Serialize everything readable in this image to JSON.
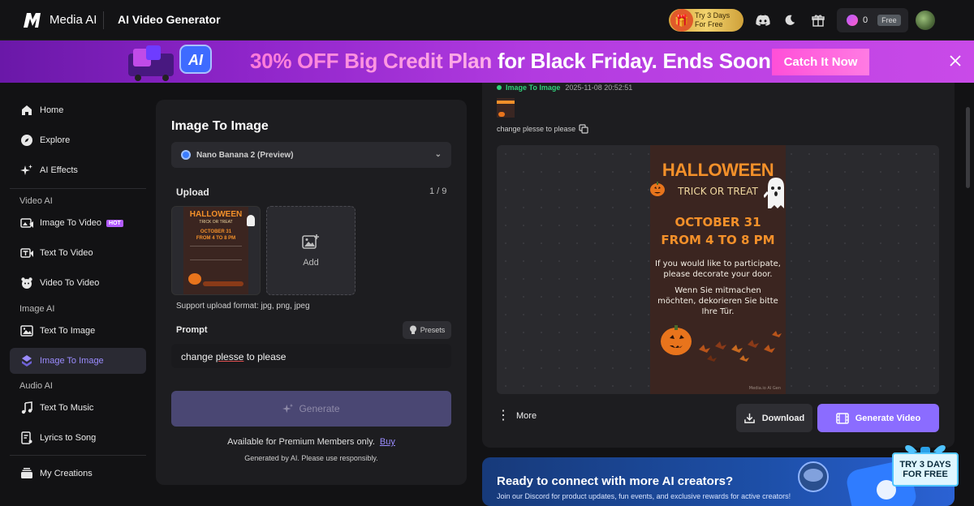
{
  "app": {
    "brand": "Media AI",
    "tool_title": "AI Video Generator"
  },
  "topbar": {
    "trial_line1": "Try 3 Days",
    "trial_line2": "For Free",
    "credits": "0",
    "plan_badge": "Free"
  },
  "banner": {
    "highlight": "30% OFF Big Credit Plan",
    "rest": " for Black Friday. Ends Soon.",
    "cta": "Catch It Now",
    "ai_badge": "AI"
  },
  "sidebar": {
    "home": "Home",
    "explore": "Explore",
    "ai_effects": "AI Effects",
    "section_video": "Video AI",
    "image_to_video": "Image To Video",
    "hot": "HOT",
    "text_to_video": "Text To Video",
    "video_to_video": "Video To Video",
    "section_image": "Image AI",
    "text_to_image": "Text To Image",
    "image_to_image": "Image To Image",
    "section_audio": "Audio AI",
    "text_to_music": "Text To Music",
    "lyrics_to_song": "Lyrics to Song",
    "my_creations": "My Creations"
  },
  "panel": {
    "title": "Image To Image",
    "model": "Nano Banana 2 (Preview)",
    "upload_label": "Upload",
    "upload_count": "1 / 9",
    "add_label": "Add",
    "support": "Support upload format: jpg, png, jpeg",
    "prompt_label": "Prompt",
    "presets": "Presets",
    "prompt_before": "change ",
    "prompt_misspelled": "plesse",
    "prompt_after": " to please",
    "generate": "Generate",
    "available": "Available for Premium Members only.",
    "buy": "Buy",
    "disclaimer": "Generated by AI. Please use responsibly."
  },
  "result": {
    "tag": "Image To Image",
    "time": "2025-11-08 20:52:51",
    "prompt": "change plesse to please",
    "more": "More",
    "download": "Download",
    "generate_video": "Generate Video"
  },
  "poster": {
    "title": "HALLOWEEN",
    "subtitle": "TRICK OR TREAT",
    "date1": "OCTOBER 31",
    "date2": "FROM 4 TO 8 PM",
    "english": "If you would like to participate, please decorate your door.",
    "german": "Wenn Sie mitmachen möchten, dekorieren Sie bitte Ihre Tür.",
    "watermark": "Media.io AI Gen"
  },
  "thumb_poster": {
    "title": "HALLOWEEN",
    "subtitle": "TRICK OR TREAT",
    "date1": "OCTOBER 31",
    "date2": "FROM 4 TO 8 PM"
  },
  "discord": {
    "title": "Ready to connect with more AI creators?",
    "subtitle": "Join our Discord for product updates, fun events, and exclusive rewards for active creators!"
  },
  "promo": {
    "line1": "TRY 3 DAYS",
    "line2": "FOR FREE"
  },
  "colors": {
    "accent": "#8b6cff",
    "success": "#2fd17a",
    "banner_pink": "#ff4fd8"
  }
}
